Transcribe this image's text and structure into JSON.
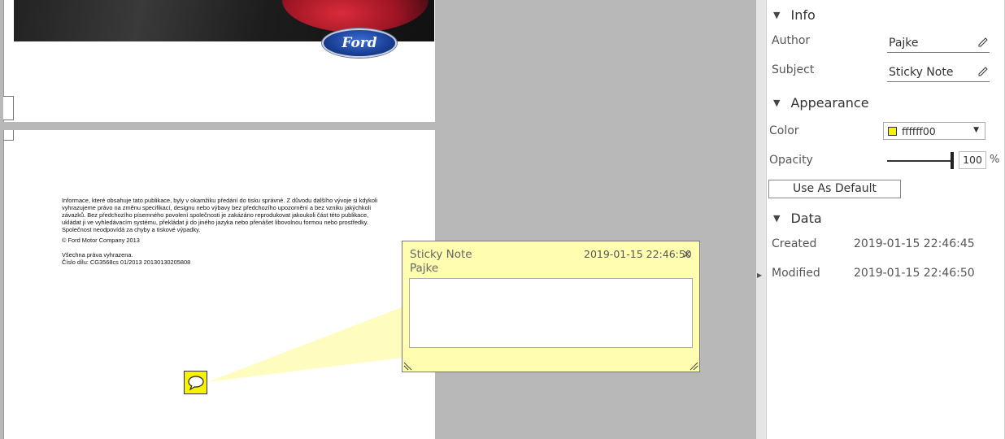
{
  "document": {
    "logo_text": "Ford",
    "legal_paragraph": "Informace, které obsahuje tato publikace, byly v okamžiku předání do tisku správné. Z důvodu dalšího vývoje si kdykoli vyhrazujeme právo na změnu specifikací, designu nebo výbavy bez předchozího upozornění a bez vzniku jakýchkoli závazků. Bez předchozího písemného povolení společnosti je zakázáno reprodukovat jakoukoli část této publikace, ukládat ji ve vyhledávacím systému, překládat ji do jiného jazyka nebo přenášet libovolnou formou nebo prostředky. Společnost neodpovídá za chyby a tiskové výpadky.",
    "copyright": "© Ford Motor Company 2013",
    "rights": "Všechna práva vyhrazena.",
    "part_number": "Číslo dílu: CG3568cs 01/2013 20130130205808"
  },
  "popup": {
    "subject": "Sticky Note",
    "author": "Pajke",
    "date": "2019-01-15 22:46:50",
    "close_glyph": "×"
  },
  "panel": {
    "info": {
      "header": "Info",
      "author_label": "Author",
      "author_value": "Pajke",
      "subject_label": "Subject",
      "subject_value": "Sticky Note"
    },
    "appearance": {
      "header": "Appearance",
      "color_label": "Color",
      "color_value": "ffffff00",
      "opacity_label": "Opacity",
      "opacity_value": "100",
      "opacity_unit": "%",
      "opacity_level": 1.0,
      "default_button": "Use As Default"
    },
    "data": {
      "header": "Data",
      "created_label": "Created",
      "created_value": "2019-01-15 22:46:45",
      "modified_label": "Modified",
      "modified_value": "2019-01-15 22:46:50"
    }
  },
  "colors": {
    "note_yellow": "#f7f200",
    "popup_bg": "#fffeb0",
    "viewer_bg": "#b8b8b8"
  },
  "icons": [
    "sticky-note-icon",
    "close-icon",
    "pencil-icon",
    "dropdown-arrow-icon",
    "collapse-triangle-icon",
    "resize-handle-icon"
  ]
}
